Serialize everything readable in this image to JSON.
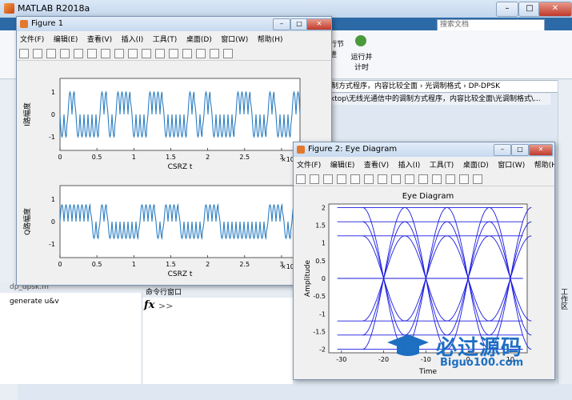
{
  "app": {
    "title": "MATLAB R2018a",
    "search_placeholder": "搜索文档",
    "path_current": "制方式程序，内容比较全面 › 光调制格式 › DP-DPSK",
    "path_file": "ktop\\无线光通信中的调制方式程序，内容比较全面\\光调制格式\\...",
    "ribbon_label_1": "行节",
    "ribbon_label_1b": "进",
    "ribbon_run_label": "运行并\n计时",
    "workspace_title": "dp_dpsk.m",
    "workspace_text": "generate u&v",
    "cmd_title": "命令行窗口",
    "cmd_prompt": "fx",
    "cmd_chevrons": ">>",
    "right_panel_label": "工作区",
    "accent": "#2b6aa6"
  },
  "figure1": {
    "title": "Figure 1",
    "menu": [
      "文件(F)",
      "编辑(E)",
      "查看(V)",
      "插入(I)",
      "工具(T)",
      "桌面(D)",
      "窗口(W)",
      "帮助(H)"
    ],
    "top_plot": {
      "ylabel": "I路幅度",
      "xlabel": "CSRZ   t",
      "xticks": [
        "0",
        "0.5",
        "1",
        "1.5",
        "2",
        "2.5",
        "3"
      ],
      "yticks": [
        "1",
        "0",
        "-1"
      ],
      "exp": "×10"
    },
    "bottom_plot": {
      "ylabel": "Q路幅度",
      "xlabel": "CSRZ   t",
      "xticks": [
        "0",
        "0.5",
        "1",
        "1.5",
        "2",
        "2.5",
        "3"
      ],
      "yticks": [
        "1",
        "0",
        "-1"
      ],
      "exp": "×10"
    },
    "line_color": "#2e7fc4"
  },
  "figure2": {
    "title": "Figure 2: Eye Diagram",
    "menu": [
      "文件(F)",
      "编辑(E)",
      "查看(V)",
      "插入(I)",
      "工具(T)",
      "桌面(D)",
      "窗口(W)",
      "帮助(H)"
    ],
    "plot_title": "Eye Diagram",
    "ylabel": "Amplitude",
    "xlabel": "Time",
    "xticks": [
      "-30",
      "-20",
      "-10",
      "0",
      "10"
    ],
    "yticks": [
      "2",
      "1.5",
      "1",
      "0.5",
      "0",
      "-0.5",
      "-1",
      "-1.5",
      "-2"
    ],
    "line_color": "#1a1adf"
  },
  "watermark": {
    "text": "必过源码",
    "url": "Biguo100.com"
  }
}
